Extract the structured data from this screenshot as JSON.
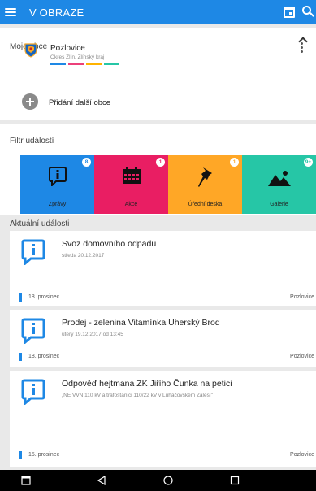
{
  "appbar": {
    "title": "V OBRAZE"
  },
  "moje_obce": {
    "title": "Moje obce",
    "obec": {
      "name": "Pozlovice",
      "region": "Okres Zlín, Zlínský kraj",
      "stripe_colors": [
        "#1e88e5",
        "#ec407a",
        "#ffb300",
        "#26c6a6"
      ]
    },
    "add_label": "Přidání další obce"
  },
  "filtr": {
    "title": "Filtr událostí",
    "tiles": [
      {
        "label": "Zprávy",
        "badge": "8",
        "color": "#1e88e5",
        "icon": "info-icon"
      },
      {
        "label": "Akce",
        "badge": "1",
        "color": "#e91e63",
        "icon": "calendar-icon"
      },
      {
        "label": "Úřední deska",
        "badge": "1",
        "color": "#ffa726",
        "icon": "pin-icon"
      },
      {
        "label": "Galerie",
        "badge": "9+",
        "color": "#26c6a6",
        "icon": "image-icon"
      }
    ]
  },
  "aktualni": {
    "title": "Aktuální události",
    "events": [
      {
        "title": "Svoz domovního odpadu",
        "subtitle": "středa 20.12.2017",
        "date": "18. prosinec",
        "place": "Pozlovice"
      },
      {
        "title": "Prodej - zelenina Vitamínka Uherský Brod",
        "subtitle": "úterý 19.12.2017 od 13:45",
        "date": "18. prosinec",
        "place": "Pozlovice"
      },
      {
        "title": "Odpověď hejtmana ZK Jiřího Čunka na petici",
        "subtitle": "„NE VVN 110 kV a trafostanici 110/22 kV v Luhačovském Zálesí\"",
        "date": "15. prosinec",
        "place": "Pozlovice"
      }
    ]
  },
  "colors": {
    "accent": "#1e88e5"
  }
}
